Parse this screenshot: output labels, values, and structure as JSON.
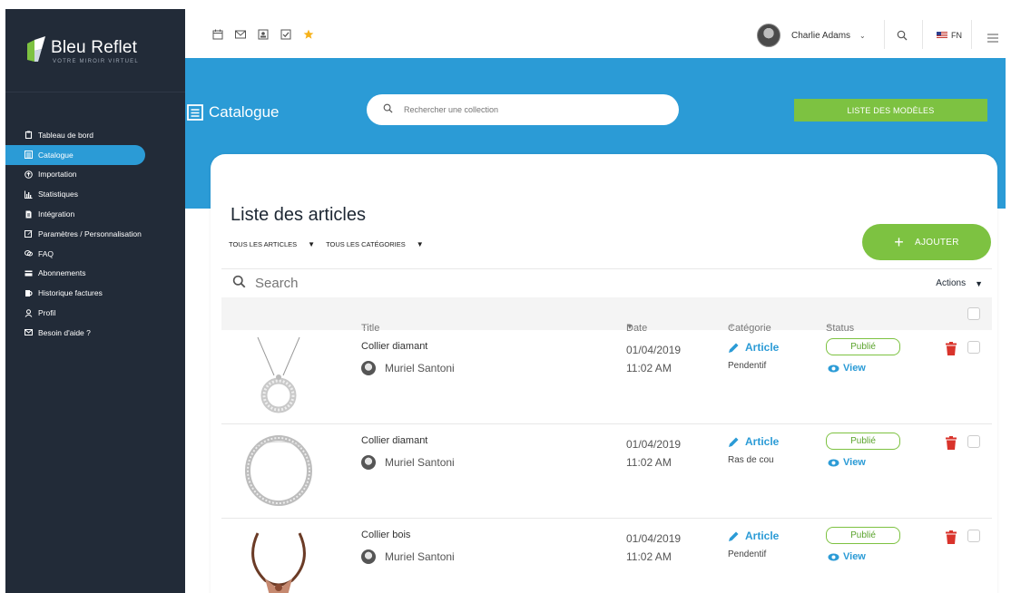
{
  "brand": {
    "name": "Bleu Reflet",
    "tagline": "VOTRE MIROIR VIRTUEL"
  },
  "sidebar": {
    "items": [
      {
        "label": "Tableau de bord",
        "icon": "clipboard-icon"
      },
      {
        "label": "Catalogue",
        "icon": "list-icon",
        "active": true
      },
      {
        "label": "Importation",
        "icon": "upload-circle-icon"
      },
      {
        "label": "Statistiques",
        "icon": "bar-chart-icon"
      },
      {
        "label": "Intégration",
        "icon": "document-icon"
      },
      {
        "label": "Paramètres / Personnalisation",
        "icon": "edit-icon"
      },
      {
        "label": "FAQ",
        "icon": "chat-icon"
      },
      {
        "label": "Abonnements",
        "icon": "card-icon"
      },
      {
        "label": "Historique factures",
        "icon": "invoice-icon"
      },
      {
        "label": "Profil",
        "icon": "user-icon"
      },
      {
        "label": "Besoin d'aide ?",
        "icon": "mail-icon"
      }
    ]
  },
  "topbar": {
    "user_name": "Charlie Adams",
    "language": "FN"
  },
  "header": {
    "title": "Catalogue",
    "search_placeholder": "Rechercher une collection",
    "models_button": "LISTE DES MODÈLES"
  },
  "list": {
    "title": "Liste des articles",
    "filter_articles": "TOUS LES ARTICLES",
    "filter_categories": "TOUS LES CATÉGORIES",
    "add_button": "AJOUTER",
    "search_placeholder": "Search",
    "actions_label": "Actions",
    "columns": {
      "title": "Title",
      "date": "Date",
      "category": "Catégorie",
      "status": "Status"
    },
    "rows": [
      {
        "title": "Collier diamant",
        "author": "Muriel Santoni",
        "date": "01/04/2019",
        "time": "11:02 AM",
        "category": "Article",
        "subcategory": "Pendentif",
        "status": "Publié",
        "view": "View"
      },
      {
        "title": "Collier diamant",
        "author": "Muriel Santoni",
        "date": "01/04/2019",
        "time": "11:02 AM",
        "category": "Article",
        "subcategory": "Ras de cou",
        "status": "Publié",
        "view": "View"
      },
      {
        "title": "Collier bois",
        "author": "Muriel Santoni",
        "date": "01/04/2019",
        "time": "11:02 AM",
        "category": "Article",
        "subcategory": "Pendentif",
        "status": "Publié",
        "view": "View"
      }
    ]
  },
  "colors": {
    "sidebar_bg": "#222b38",
    "accent_blue": "#2b9bd6",
    "accent_green": "#7dc241",
    "delete_red": "#d9332b"
  }
}
